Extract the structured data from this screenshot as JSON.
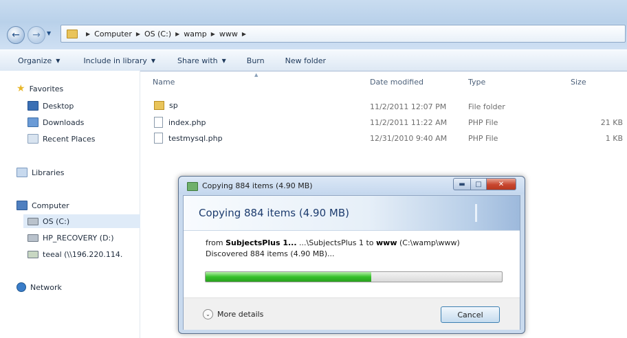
{
  "breadcrumb": [
    "Computer",
    "OS (C:)",
    "wamp",
    "www"
  ],
  "toolbar": {
    "organize": "Organize",
    "include_in_library": "Include in library",
    "share_with": "Share with",
    "burn": "Burn",
    "new_folder": "New folder"
  },
  "sidebar": {
    "favorites": "Favorites",
    "desktop": "Desktop",
    "downloads": "Downloads",
    "recent_places": "Recent Places",
    "libraries": "Libraries",
    "computer": "Computer",
    "os_c": "OS (C:)",
    "hp_recovery": "HP_RECOVERY (D:)",
    "teeal": "teeal (\\\\196.220.114.",
    "network": "Network"
  },
  "columns": {
    "name": "Name",
    "date_modified": "Date modified",
    "type": "Type",
    "size": "Size"
  },
  "files": [
    {
      "name": "sp",
      "date": "11/2/2011 12:07 PM",
      "type": "File folder",
      "size": ""
    },
    {
      "name": "index.php",
      "date": "11/2/2011 11:22 AM",
      "type": "PHP File",
      "size": "21 KB"
    },
    {
      "name": "testmysql.php",
      "date": "12/31/2010 9:40 AM",
      "type": "PHP File",
      "size": "1 KB"
    }
  ],
  "dialog": {
    "title": "Copying 884 items (4.90 MB)",
    "heading": "Copying 884 items (4.90 MB)",
    "from_prefix": "from ",
    "source_bold": "SubjectsPlus 1...",
    "source_path": " ...\\SubjectsPlus 1 to ",
    "dest_bold": "www",
    "dest_path": " (C:\\wamp\\www)",
    "discovered": "Discovered 884 items (4.90 MB)...",
    "progress_fraction": 0.56,
    "more_details": "More details",
    "cancel": "Cancel"
  },
  "icons": {
    "back": "back-arrow-icon",
    "forward": "forward-arrow-icon",
    "favorites": "star-icon",
    "close": "close-icon"
  },
  "colors": {
    "progress": "#36c12a",
    "accent": "#1d3c6e"
  }
}
